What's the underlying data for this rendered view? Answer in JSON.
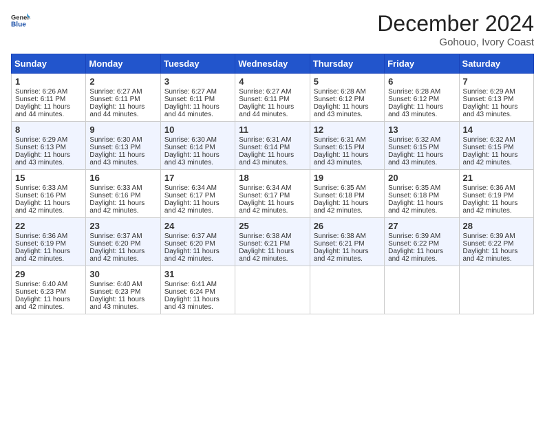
{
  "header": {
    "logo_line1": "General",
    "logo_line2": "Blue",
    "month": "December 2024",
    "location": "Gohouo, Ivory Coast"
  },
  "days_of_week": [
    "Sunday",
    "Monday",
    "Tuesday",
    "Wednesday",
    "Thursday",
    "Friday",
    "Saturday"
  ],
  "weeks": [
    [
      {
        "day": "1",
        "sunrise": "6:26 AM",
        "sunset": "6:11 PM",
        "daylight": "11 hours and 44 minutes."
      },
      {
        "day": "2",
        "sunrise": "6:27 AM",
        "sunset": "6:11 PM",
        "daylight": "11 hours and 44 minutes."
      },
      {
        "day": "3",
        "sunrise": "6:27 AM",
        "sunset": "6:11 PM",
        "daylight": "11 hours and 44 minutes."
      },
      {
        "day": "4",
        "sunrise": "6:27 AM",
        "sunset": "6:11 PM",
        "daylight": "11 hours and 44 minutes."
      },
      {
        "day": "5",
        "sunrise": "6:28 AM",
        "sunset": "6:12 PM",
        "daylight": "11 hours and 43 minutes."
      },
      {
        "day": "6",
        "sunrise": "6:28 AM",
        "sunset": "6:12 PM",
        "daylight": "11 hours and 43 minutes."
      },
      {
        "day": "7",
        "sunrise": "6:29 AM",
        "sunset": "6:13 PM",
        "daylight": "11 hours and 43 minutes."
      }
    ],
    [
      {
        "day": "8",
        "sunrise": "6:29 AM",
        "sunset": "6:13 PM",
        "daylight": "11 hours and 43 minutes."
      },
      {
        "day": "9",
        "sunrise": "6:30 AM",
        "sunset": "6:13 PM",
        "daylight": "11 hours and 43 minutes."
      },
      {
        "day": "10",
        "sunrise": "6:30 AM",
        "sunset": "6:14 PM",
        "daylight": "11 hours and 43 minutes."
      },
      {
        "day": "11",
        "sunrise": "6:31 AM",
        "sunset": "6:14 PM",
        "daylight": "11 hours and 43 minutes."
      },
      {
        "day": "12",
        "sunrise": "6:31 AM",
        "sunset": "6:15 PM",
        "daylight": "11 hours and 43 minutes."
      },
      {
        "day": "13",
        "sunrise": "6:32 AM",
        "sunset": "6:15 PM",
        "daylight": "11 hours and 43 minutes."
      },
      {
        "day": "14",
        "sunrise": "6:32 AM",
        "sunset": "6:15 PM",
        "daylight": "11 hours and 42 minutes."
      }
    ],
    [
      {
        "day": "15",
        "sunrise": "6:33 AM",
        "sunset": "6:16 PM",
        "daylight": "11 hours and 42 minutes."
      },
      {
        "day": "16",
        "sunrise": "6:33 AM",
        "sunset": "6:16 PM",
        "daylight": "11 hours and 42 minutes."
      },
      {
        "day": "17",
        "sunrise": "6:34 AM",
        "sunset": "6:17 PM",
        "daylight": "11 hours and 42 minutes."
      },
      {
        "day": "18",
        "sunrise": "6:34 AM",
        "sunset": "6:17 PM",
        "daylight": "11 hours and 42 minutes."
      },
      {
        "day": "19",
        "sunrise": "6:35 AM",
        "sunset": "6:18 PM",
        "daylight": "11 hours and 42 minutes."
      },
      {
        "day": "20",
        "sunrise": "6:35 AM",
        "sunset": "6:18 PM",
        "daylight": "11 hours and 42 minutes."
      },
      {
        "day": "21",
        "sunrise": "6:36 AM",
        "sunset": "6:19 PM",
        "daylight": "11 hours and 42 minutes."
      }
    ],
    [
      {
        "day": "22",
        "sunrise": "6:36 AM",
        "sunset": "6:19 PM",
        "daylight": "11 hours and 42 minutes."
      },
      {
        "day": "23",
        "sunrise": "6:37 AM",
        "sunset": "6:20 PM",
        "daylight": "11 hours and 42 minutes."
      },
      {
        "day": "24",
        "sunrise": "6:37 AM",
        "sunset": "6:20 PM",
        "daylight": "11 hours and 42 minutes."
      },
      {
        "day": "25",
        "sunrise": "6:38 AM",
        "sunset": "6:21 PM",
        "daylight": "11 hours and 42 minutes."
      },
      {
        "day": "26",
        "sunrise": "6:38 AM",
        "sunset": "6:21 PM",
        "daylight": "11 hours and 42 minutes."
      },
      {
        "day": "27",
        "sunrise": "6:39 AM",
        "sunset": "6:22 PM",
        "daylight": "11 hours and 42 minutes."
      },
      {
        "day": "28",
        "sunrise": "6:39 AM",
        "sunset": "6:22 PM",
        "daylight": "11 hours and 42 minutes."
      }
    ],
    [
      {
        "day": "29",
        "sunrise": "6:40 AM",
        "sunset": "6:23 PM",
        "daylight": "11 hours and 42 minutes."
      },
      {
        "day": "30",
        "sunrise": "6:40 AM",
        "sunset": "6:23 PM",
        "daylight": "11 hours and 43 minutes."
      },
      {
        "day": "31",
        "sunrise": "6:41 AM",
        "sunset": "6:24 PM",
        "daylight": "11 hours and 43 minutes."
      },
      null,
      null,
      null,
      null
    ]
  ],
  "labels": {
    "sunrise": "Sunrise:",
    "sunset": "Sunset:",
    "daylight": "Daylight:"
  }
}
